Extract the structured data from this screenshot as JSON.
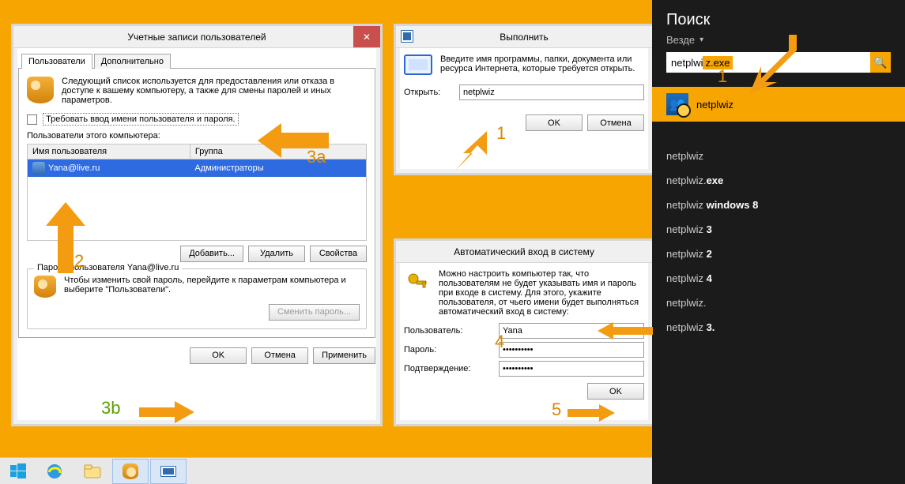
{
  "search": {
    "title": "Поиск",
    "scope": "Везде",
    "query_left": "netplwi",
    "query_hl": "z.exe",
    "search_icon": "🔍",
    "top_hit": "netplwiz",
    "suggestions": [
      {
        "a": "netplwiz",
        "b": ""
      },
      {
        "a": "netplwiz.",
        "b": "exe"
      },
      {
        "a": "netplwiz ",
        "b": "windows 8"
      },
      {
        "a": "netplwiz ",
        "b": "3"
      },
      {
        "a": "netplwiz ",
        "b": "2"
      },
      {
        "a": "netplwiz ",
        "b": "4"
      },
      {
        "a": "netplwiz.",
        "b": ""
      },
      {
        "a": "netplwiz ",
        "b": "3."
      }
    ]
  },
  "accounts": {
    "title": "Учетные записи пользователей",
    "tabs": {
      "users": "Пользователи",
      "advanced": "Дополнительно"
    },
    "intro": "Следующий список используется для предоставления или отказа в доступе к вашему компьютеру, а также для смены паролей и иных параметров.",
    "checkbox": "Требовать ввод имени пользователя и пароля.",
    "list_label": "Пользователи этого компьютера:",
    "cols": {
      "name": "Имя пользователя",
      "group": "Группа"
    },
    "row": {
      "name": "Yana@live.ru",
      "group": "Администраторы"
    },
    "btn_add": "Добавить...",
    "btn_remove": "Удалить",
    "btn_props": "Свойства",
    "pw_group_title": "Пароль пользователя Yana@live.ru",
    "pw_help": "Чтобы изменить свой пароль, перейдите к параметрам компьютера и выберите \"Пользователи\".",
    "btn_changepw": "Сменить пароль...",
    "ok": "OK",
    "cancel": "Отмена",
    "apply": "Применить"
  },
  "run": {
    "title": "Выполнить",
    "help": "Введите имя программы, папки, документа или ресурса Интернета, которые требуется открыть.",
    "open_label": "Открыть:",
    "value": "netplwiz",
    "ok": "OK",
    "cancel": "Отмена"
  },
  "auto": {
    "title": "Автоматический вход в систему",
    "help": "Можно настроить компьютер так, что пользователям не будет указывать имя и пароль при входе в систему. Для этого, укажите пользователя, от чьего имени будет выполняться автоматический вход в систему:",
    "user_label": "Пользователь:",
    "user_value": "Yana",
    "pw_label": "Пароль:",
    "pw_value": "••••••••••",
    "pw2_label": "Подтверждение:",
    "pw2_value": "••••••••••",
    "ok": "OK"
  },
  "anno": {
    "l1": "1",
    "l2": "2",
    "l3a": "3a",
    "l3b": "3b",
    "l4": "4",
    "l5": "5"
  }
}
